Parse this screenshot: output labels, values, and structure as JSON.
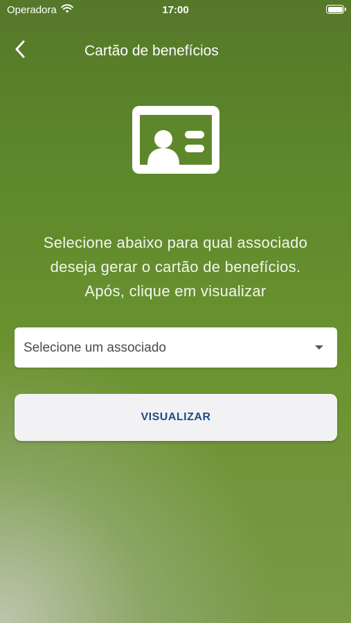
{
  "status_bar": {
    "carrier": "Operadora",
    "time": "17:00",
    "icons": [
      "wifi-icon",
      "battery-icon"
    ]
  },
  "nav": {
    "title": "Cartão de benefícios",
    "back_icon": "chevron-left-icon"
  },
  "hero": {
    "icon": "id-card-icon"
  },
  "instructions": {
    "line1": "Selecione abaixo para qual associado",
    "line2": "deseja gerar o cartão de benefícios.",
    "line3": "Após, clique em visualizar"
  },
  "form": {
    "select_placeholder": "Selecione um associado",
    "select_icon": "caret-down-icon",
    "view_button_label": "VISUALIZAR"
  },
  "colors": {
    "background_top": "#55782a",
    "background_bottom": "#7a9a48",
    "button_text": "#1c4d85",
    "button_bg": "#f2f2f5"
  }
}
